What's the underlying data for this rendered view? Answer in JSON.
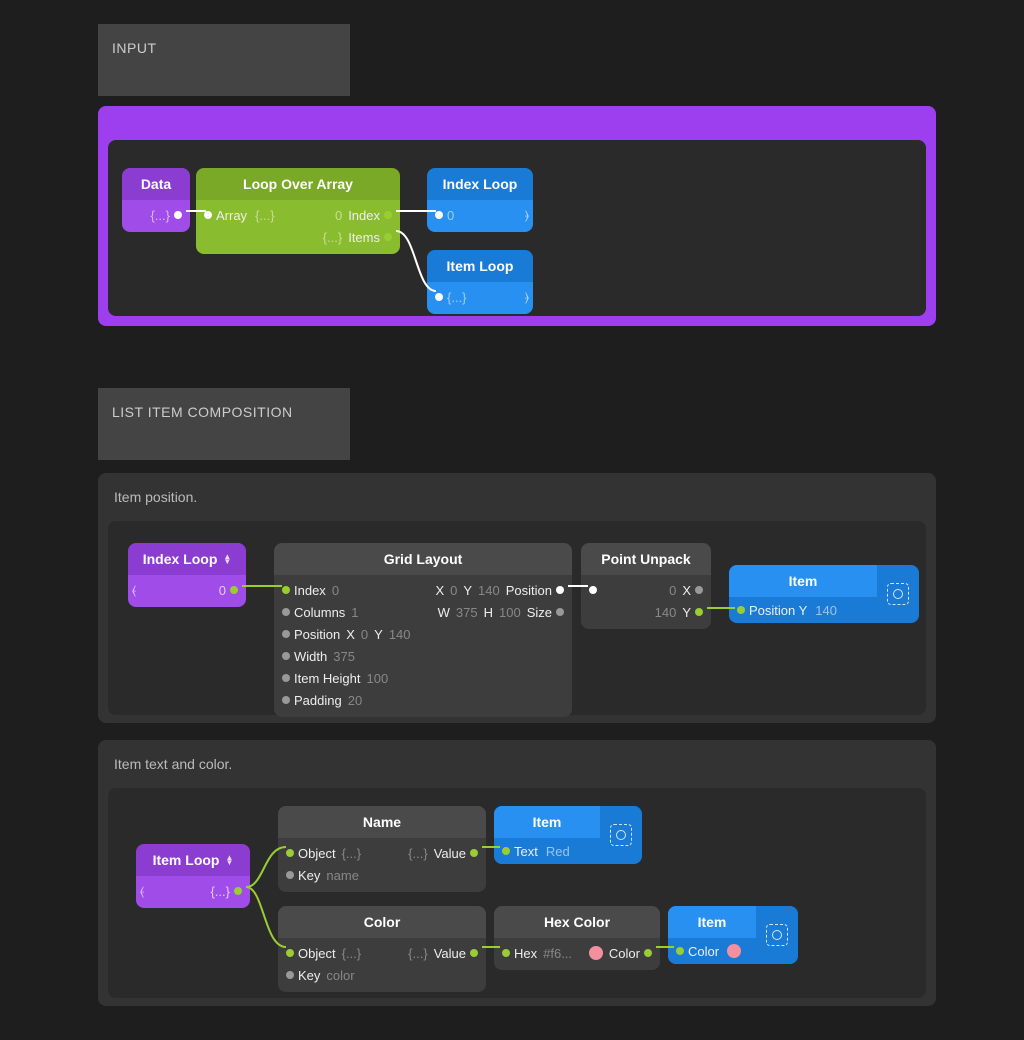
{
  "labels": {
    "input": "INPUT",
    "composition": "LIST ITEM COMPOSITION"
  },
  "section1": {
    "nodes": {
      "data": {
        "title": "Data",
        "body": "{...}"
      },
      "loop": {
        "title": "Loop Over Array",
        "in": "Array",
        "in_val": "{...}",
        "out1": "Index",
        "out1_val": "0",
        "out2": "Items",
        "out2_val": "{...}"
      },
      "indexLoop": {
        "title": "Index Loop",
        "val": "0"
      },
      "itemLoop": {
        "title": "Item Loop",
        "val": "{...}"
      }
    }
  },
  "section2": {
    "header": "Item position.",
    "indexLoop": {
      "title": "Index Loop",
      "val": "0"
    },
    "grid": {
      "title": "Grid Layout",
      "inputs": {
        "index": "Index",
        "index_v": "0",
        "columns": "Columns",
        "columns_v": "1",
        "position": "Position",
        "pos_x": "X",
        "pos_x_v": "0",
        "pos_y": "Y",
        "pos_y_v": "140",
        "width": "Width",
        "width_v": "375",
        "height": "Item Height",
        "height_v": "100",
        "padding": "Padding",
        "padding_v": "20"
      },
      "outputs": {
        "position": "Position",
        "pos_x": "X",
        "pos_x_v": "0",
        "pos_y": "Y",
        "pos_y_v": "140",
        "size": "Size",
        "size_w": "W",
        "size_w_v": "375",
        "size_h": "H",
        "size_h_v": "100"
      }
    },
    "unpack": {
      "title": "Point Unpack",
      "x": "X",
      "x_v": "0",
      "y": "Y",
      "y_v": "140"
    },
    "item": {
      "title": "Item",
      "port": "Position Y",
      "val": "140"
    }
  },
  "section3": {
    "header": "Item text and color.",
    "itemLoop": {
      "title": "Item Loop",
      "val": "{...}"
    },
    "name": {
      "title": "Name",
      "object": "Object",
      "object_v": "{...}",
      "key": "Key",
      "key_v": "name",
      "value": "Value",
      "value_v": "{...}"
    },
    "itemText": {
      "title": "Item",
      "port": "Text",
      "val": "Red"
    },
    "color": {
      "title": "Color",
      "object": "Object",
      "object_v": "{...}",
      "key": "Key",
      "key_v": "color",
      "value": "Value",
      "value_v": "{...}"
    },
    "hexColor": {
      "title": "Hex Color",
      "hex": "Hex",
      "hex_v": "#f6...",
      "color": "Color"
    },
    "itemColor": {
      "title": "Item",
      "port": "Color"
    }
  },
  "colors": {
    "swatch": "#f48fa0"
  }
}
